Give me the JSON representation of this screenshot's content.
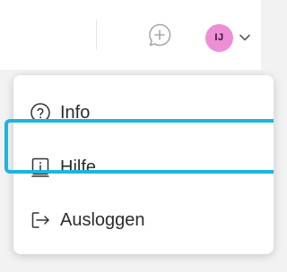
{
  "header": {
    "avatar_initials": "IJ",
    "avatar_color": "#ec8fd4",
    "compose_icon": "chat-add-icon"
  },
  "menu": {
    "items": [
      {
        "label": "Info",
        "icon": "question-circle-icon"
      },
      {
        "label": "Hilfe",
        "icon": "info-square-icon"
      },
      {
        "label": "Ausloggen",
        "icon": "logout-arrow-icon"
      }
    ],
    "focused_item": "Hilfe",
    "focus_color": "#20b3dd"
  }
}
